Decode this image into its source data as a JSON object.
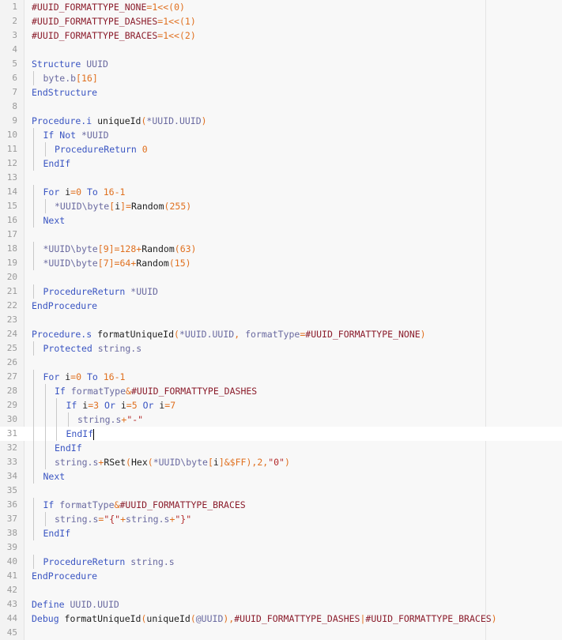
{
  "editor": {
    "language": "PureBasic",
    "current_line": 31,
    "lines": [
      {
        "n": "1",
        "indent": 0,
        "tokens": [
          [
            "con",
            "#UUID_FORMATTYPE_NONE"
          ],
          [
            "op",
            "="
          ],
          [
            "num",
            "1"
          ],
          [
            "op",
            "<<"
          ],
          [
            "op",
            "("
          ],
          [
            "num",
            "0"
          ],
          [
            "op",
            ")"
          ]
        ]
      },
      {
        "n": "2",
        "indent": 0,
        "tokens": [
          [
            "con",
            "#UUID_FORMATTYPE_DASHES"
          ],
          [
            "op",
            "="
          ],
          [
            "num",
            "1"
          ],
          [
            "op",
            "<<"
          ],
          [
            "op",
            "("
          ],
          [
            "num",
            "1"
          ],
          [
            "op",
            ")"
          ]
        ]
      },
      {
        "n": "3",
        "indent": 0,
        "tokens": [
          [
            "con",
            "#UUID_FORMATTYPE_BRACES"
          ],
          [
            "op",
            "="
          ],
          [
            "num",
            "1"
          ],
          [
            "op",
            "<<"
          ],
          [
            "op",
            "("
          ],
          [
            "num",
            "2"
          ],
          [
            "op",
            ")"
          ]
        ]
      },
      {
        "n": "4",
        "indent": 0,
        "tokens": []
      },
      {
        "n": "5",
        "indent": 0,
        "tokens": [
          [
            "kw",
            "Structure"
          ],
          [
            "id",
            " "
          ],
          [
            "type",
            "UUID"
          ]
        ]
      },
      {
        "n": "6",
        "indent": 1,
        "tokens": [
          [
            "type",
            "byte.b"
          ],
          [
            "op",
            "["
          ],
          [
            "num",
            "16"
          ],
          [
            "op",
            "]"
          ]
        ]
      },
      {
        "n": "7",
        "indent": 0,
        "tokens": [
          [
            "kw",
            "EndStructure"
          ]
        ]
      },
      {
        "n": "8",
        "indent": 0,
        "tokens": []
      },
      {
        "n": "9",
        "indent": 0,
        "tokens": [
          [
            "kw",
            "Procedure.i"
          ],
          [
            "id",
            " uniqueId"
          ],
          [
            "op",
            "("
          ],
          [
            "ptr",
            "*UUID.UUID"
          ],
          [
            "op",
            ")"
          ]
        ]
      },
      {
        "n": "10",
        "indent": 1,
        "tokens": [
          [
            "kw",
            "If Not"
          ],
          [
            "id",
            " "
          ],
          [
            "ptr",
            "*UUID"
          ]
        ]
      },
      {
        "n": "11",
        "indent": 2,
        "tokens": [
          [
            "kw",
            "ProcedureReturn"
          ],
          [
            "id",
            " "
          ],
          [
            "num",
            "0"
          ]
        ]
      },
      {
        "n": "12",
        "indent": 1,
        "tokens": [
          [
            "kw",
            "EndIf"
          ]
        ]
      },
      {
        "n": "13",
        "indent": 0,
        "tokens": []
      },
      {
        "n": "14",
        "indent": 1,
        "tokens": [
          [
            "kw",
            "For"
          ],
          [
            "id",
            " i"
          ],
          [
            "op",
            "="
          ],
          [
            "num",
            "0"
          ],
          [
            "id",
            " "
          ],
          [
            "kw",
            "To"
          ],
          [
            "id",
            " "
          ],
          [
            "num",
            "16"
          ],
          [
            "op",
            "-"
          ],
          [
            "num",
            "1"
          ]
        ]
      },
      {
        "n": "15",
        "indent": 2,
        "tokens": [
          [
            "ptr",
            "*UUID\\byte"
          ],
          [
            "op",
            "["
          ],
          [
            "id",
            "i"
          ],
          [
            "op",
            "]="
          ],
          [
            "id",
            "Random"
          ],
          [
            "op",
            "("
          ],
          [
            "num",
            "255"
          ],
          [
            "op",
            ")"
          ]
        ]
      },
      {
        "n": "16",
        "indent": 1,
        "tokens": [
          [
            "kw",
            "Next"
          ]
        ]
      },
      {
        "n": "17",
        "indent": 0,
        "tokens": []
      },
      {
        "n": "18",
        "indent": 1,
        "tokens": [
          [
            "ptr",
            "*UUID\\byte"
          ],
          [
            "op",
            "["
          ],
          [
            "num",
            "9"
          ],
          [
            "op",
            "]="
          ],
          [
            "num",
            "128"
          ],
          [
            "op",
            "+"
          ],
          [
            "id",
            "Random"
          ],
          [
            "op",
            "("
          ],
          [
            "num",
            "63"
          ],
          [
            "op",
            ")"
          ]
        ]
      },
      {
        "n": "19",
        "indent": 1,
        "tokens": [
          [
            "ptr",
            "*UUID\\byte"
          ],
          [
            "op",
            "["
          ],
          [
            "num",
            "7"
          ],
          [
            "op",
            "]="
          ],
          [
            "num",
            "64"
          ],
          [
            "op",
            "+"
          ],
          [
            "id",
            "Random"
          ],
          [
            "op",
            "("
          ],
          [
            "num",
            "15"
          ],
          [
            "op",
            ")"
          ]
        ]
      },
      {
        "n": "20",
        "indent": 0,
        "tokens": []
      },
      {
        "n": "21",
        "indent": 1,
        "tokens": [
          [
            "kw",
            "ProcedureReturn"
          ],
          [
            "id",
            " "
          ],
          [
            "ptr",
            "*UUID"
          ]
        ]
      },
      {
        "n": "22",
        "indent": 0,
        "tokens": [
          [
            "kw",
            "EndProcedure"
          ]
        ]
      },
      {
        "n": "23",
        "indent": 0,
        "tokens": []
      },
      {
        "n": "24",
        "indent": 0,
        "tokens": [
          [
            "kw",
            "Procedure.s"
          ],
          [
            "id",
            " formatUniqueId"
          ],
          [
            "op",
            "("
          ],
          [
            "ptr",
            "*UUID.UUID"
          ],
          [
            "op",
            ", "
          ],
          [
            "type",
            "formatType"
          ],
          [
            "op",
            "="
          ],
          [
            "con",
            "#UUID_FORMATTYPE_NONE"
          ],
          [
            "op",
            ")"
          ]
        ]
      },
      {
        "n": "25",
        "indent": 1,
        "tokens": [
          [
            "kw",
            "Protected"
          ],
          [
            "id",
            " "
          ],
          [
            "type",
            "string.s"
          ]
        ]
      },
      {
        "n": "26",
        "indent": 0,
        "tokens": []
      },
      {
        "n": "27",
        "indent": 1,
        "tokens": [
          [
            "kw",
            "For"
          ],
          [
            "id",
            " i"
          ],
          [
            "op",
            "="
          ],
          [
            "num",
            "0"
          ],
          [
            "id",
            " "
          ],
          [
            "kw",
            "To"
          ],
          [
            "id",
            " "
          ],
          [
            "num",
            "16"
          ],
          [
            "op",
            "-"
          ],
          [
            "num",
            "1"
          ]
        ]
      },
      {
        "n": "28",
        "indent": 2,
        "tokens": [
          [
            "kw",
            "If"
          ],
          [
            "id",
            " "
          ],
          [
            "type",
            "formatType"
          ],
          [
            "op",
            "&"
          ],
          [
            "con",
            "#UUID_FORMATTYPE_DASHES"
          ]
        ]
      },
      {
        "n": "29",
        "indent": 3,
        "tokens": [
          [
            "kw",
            "If"
          ],
          [
            "id",
            " i"
          ],
          [
            "op",
            "="
          ],
          [
            "num",
            "3"
          ],
          [
            "id",
            " "
          ],
          [
            "kw",
            "Or"
          ],
          [
            "id",
            " i"
          ],
          [
            "op",
            "="
          ],
          [
            "num",
            "5"
          ],
          [
            "id",
            " "
          ],
          [
            "kw",
            "Or"
          ],
          [
            "id",
            " i"
          ],
          [
            "op",
            "="
          ],
          [
            "num",
            "7"
          ]
        ]
      },
      {
        "n": "30",
        "indent": 4,
        "tokens": [
          [
            "type",
            "string.s"
          ],
          [
            "op",
            "+"
          ],
          [
            "str",
            "\"-\""
          ]
        ]
      },
      {
        "n": "31",
        "indent": 3,
        "tokens": [
          [
            "kw",
            "EndIf"
          ]
        ]
      },
      {
        "n": "32",
        "indent": 2,
        "tokens": [
          [
            "kw",
            "EndIf"
          ]
        ]
      },
      {
        "n": "33",
        "indent": 2,
        "tokens": [
          [
            "type",
            "string.s"
          ],
          [
            "op",
            "+"
          ],
          [
            "id",
            "RSet"
          ],
          [
            "op",
            "("
          ],
          [
            "id",
            "Hex"
          ],
          [
            "op",
            "("
          ],
          [
            "ptr",
            "*UUID\\byte"
          ],
          [
            "op",
            "["
          ],
          [
            "id",
            "i"
          ],
          [
            "op",
            "]&"
          ],
          [
            "num",
            "$FF"
          ],
          [
            "op",
            "),"
          ],
          [
            "num",
            "2"
          ],
          [
            "op",
            ","
          ],
          [
            "str",
            "\"0\""
          ],
          [
            "op",
            ")"
          ]
        ]
      },
      {
        "n": "34",
        "indent": 1,
        "tokens": [
          [
            "kw",
            "Next"
          ]
        ]
      },
      {
        "n": "35",
        "indent": 0,
        "tokens": []
      },
      {
        "n": "36",
        "indent": 1,
        "tokens": [
          [
            "kw",
            "If"
          ],
          [
            "id",
            " "
          ],
          [
            "type",
            "formatType"
          ],
          [
            "op",
            "&"
          ],
          [
            "con",
            "#UUID_FORMATTYPE_BRACES"
          ]
        ]
      },
      {
        "n": "37",
        "indent": 2,
        "tokens": [
          [
            "type",
            "string.s"
          ],
          [
            "op",
            "="
          ],
          [
            "str",
            "\"{\""
          ],
          [
            "op",
            "+"
          ],
          [
            "type",
            "string.s"
          ],
          [
            "op",
            "+"
          ],
          [
            "str",
            "\"}\""
          ]
        ]
      },
      {
        "n": "38",
        "indent": 1,
        "tokens": [
          [
            "kw",
            "EndIf"
          ]
        ]
      },
      {
        "n": "39",
        "indent": 0,
        "tokens": []
      },
      {
        "n": "40",
        "indent": 1,
        "tokens": [
          [
            "kw",
            "ProcedureReturn"
          ],
          [
            "id",
            " "
          ],
          [
            "type",
            "string.s"
          ]
        ]
      },
      {
        "n": "41",
        "indent": 0,
        "tokens": [
          [
            "kw",
            "EndProcedure"
          ]
        ]
      },
      {
        "n": "42",
        "indent": 0,
        "tokens": []
      },
      {
        "n": "43",
        "indent": 0,
        "tokens": [
          [
            "kw",
            "Define"
          ],
          [
            "id",
            " "
          ],
          [
            "type",
            "UUID.UUID"
          ]
        ]
      },
      {
        "n": "44",
        "indent": 0,
        "tokens": [
          [
            "kw",
            "Debug"
          ],
          [
            "id",
            " formatUniqueId"
          ],
          [
            "op",
            "("
          ],
          [
            "id",
            "uniqueId"
          ],
          [
            "op",
            "("
          ],
          [
            "ptr",
            "@UUID"
          ],
          [
            "op",
            "),"
          ],
          [
            "con",
            "#UUID_FORMATTYPE_DASHES"
          ],
          [
            "op",
            "|"
          ],
          [
            "con",
            "#UUID_FORMATTYPE_BRACES"
          ],
          [
            "op",
            ")"
          ]
        ]
      },
      {
        "n": "45",
        "indent": 0,
        "tokens": []
      }
    ]
  }
}
